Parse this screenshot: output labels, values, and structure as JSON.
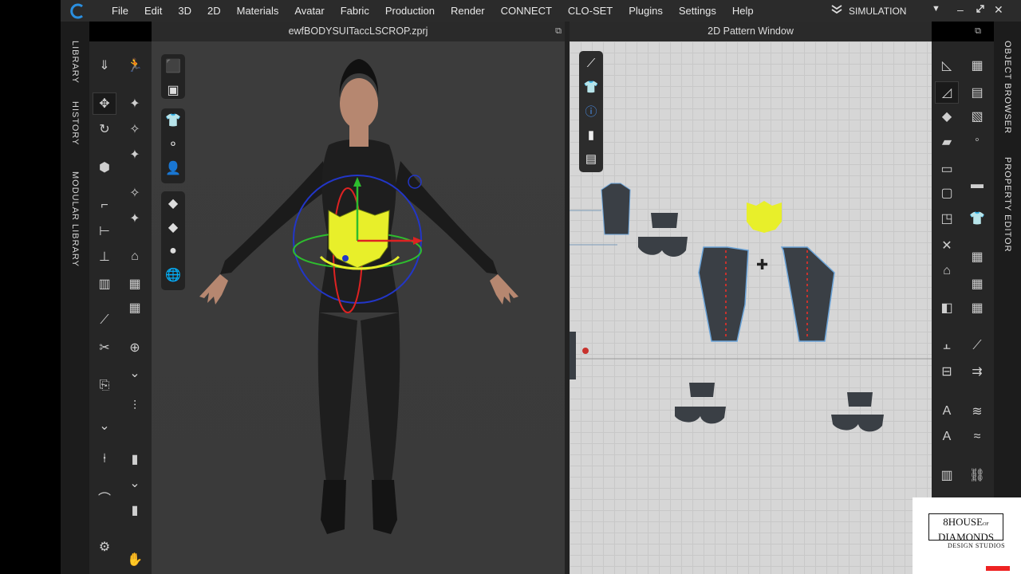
{
  "menubar": {
    "items": [
      "File",
      "Edit",
      "3D",
      "2D",
      "Materials",
      "Avatar",
      "Fabric",
      "Production",
      "Render",
      "CONNECT",
      "CLO-SET",
      "Plugins",
      "Settings",
      "Help"
    ],
    "mode_label": "SIMULATION"
  },
  "left_tabs": [
    "LIBRARY",
    "HISTORY",
    "MODULAR LIBRARY"
  ],
  "right_tabs": [
    "OBJECT BROWSER",
    "PROPERTY EDITOR"
  ],
  "viewport3d": {
    "title": "ewfBODYSUITaccLSCROP.zprj"
  },
  "pattern2d": {
    "title": "2D Pattern Window"
  },
  "brand": {
    "line1": "8HOUSE",
    "line1_small": "OF",
    "line2": "DIAMONDS",
    "line3": "DESIGN STUDIOS"
  },
  "colors": {
    "accent_yellow": "#e8ef2a",
    "garment": "#1e1e1e",
    "pattern_piece": "#3a3f45",
    "seam_red": "#c8322d",
    "selection_blue": "#2a7bd8"
  },
  "icons": {
    "logo": "clo-logo-icon",
    "mode_chevron": "double-chevron-icon",
    "dropdown": "caret-down-icon",
    "minimize": "minimize-icon",
    "restore": "restore-icon",
    "close": "close-icon"
  }
}
